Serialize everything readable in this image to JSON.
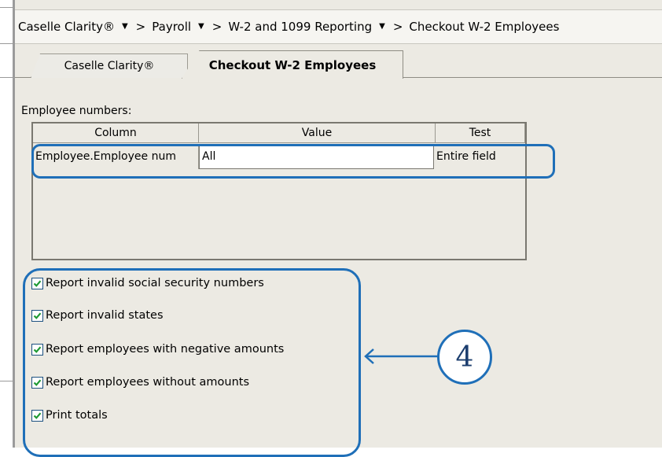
{
  "breadcrumb": {
    "items": [
      "Caselle Clarity®",
      "Payroll",
      "W-2 and 1099 Reporting",
      "Checkout W-2 Employees"
    ],
    "separator": ">",
    "dropdown_glyph": "▼"
  },
  "tabs": [
    {
      "label": "Caselle Clarity®",
      "active": false
    },
    {
      "label": "Checkout W-2 Employees",
      "active": true
    }
  ],
  "employee_grid": {
    "label": "Employee numbers:",
    "columns": [
      "Column",
      "Value",
      "Test"
    ],
    "rows": [
      {
        "column": "Employee.Employee num",
        "value": "All",
        "test": "Entire field"
      }
    ]
  },
  "options": [
    {
      "label": "Report invalid social security numbers",
      "checked": true
    },
    {
      "label": "Report invalid states",
      "checked": true
    },
    {
      "label": "Report employees with negative amounts",
      "checked": true
    },
    {
      "label": "Report employees without amounts",
      "checked": true
    },
    {
      "label": "Print totals",
      "checked": true
    }
  ],
  "annotation": {
    "callout_number": "4",
    "color": "#1f6fb8"
  },
  "colors": {
    "pane_background": "#eceae3",
    "checkbox_border": "#1c5180",
    "checkmark": "#1f9a33"
  }
}
